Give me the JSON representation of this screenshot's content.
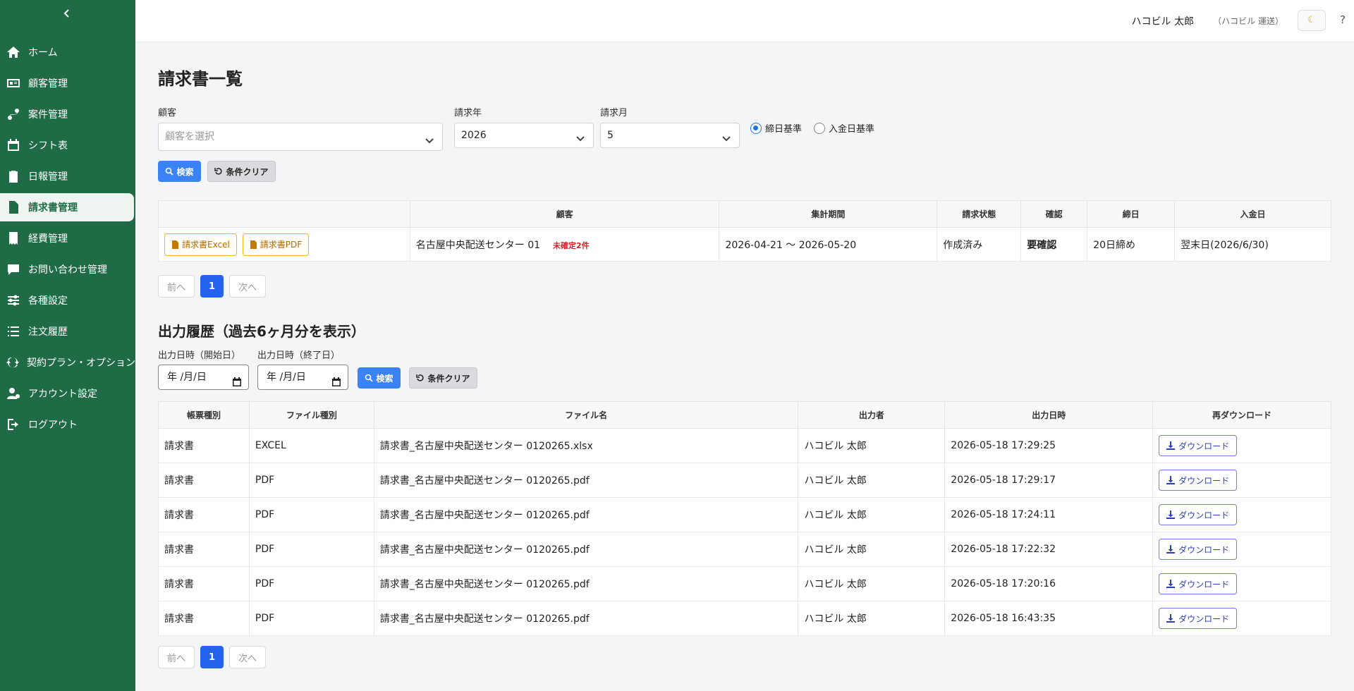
{
  "sidebar": {
    "collapse_icon": "chevron-left-icon",
    "items": [
      {
        "label": "ホーム",
        "icon": "home-icon"
      },
      {
        "label": "顧客管理",
        "icon": "id-card-icon"
      },
      {
        "label": "案件管理",
        "icon": "route-icon"
      },
      {
        "label": "シフト表",
        "icon": "calendar-icon"
      },
      {
        "label": "日報管理",
        "icon": "clipboard-icon"
      },
      {
        "label": "請求書管理",
        "icon": "invoice-icon",
        "active": true
      },
      {
        "label": "経費管理",
        "icon": "receipt-icon"
      },
      {
        "label": "お問い合わせ管理",
        "icon": "chat-icon"
      },
      {
        "label": "各種設定",
        "icon": "sliders-icon"
      },
      {
        "label": "注文履歴",
        "icon": "list-icon"
      },
      {
        "label": "契約プラン・オプション",
        "icon": "sync-icon"
      },
      {
        "label": "アカウント設定",
        "icon": "user-gear-icon"
      },
      {
        "label": "ログアウト",
        "icon": "logout-icon"
      }
    ]
  },
  "header": {
    "user_name": "ハコビル 太郎",
    "company": "（ハコビル 運送）",
    "theme_icon": "moon-icon",
    "help": "?"
  },
  "page_title": "請求書一覧",
  "filters": {
    "customer_label": "顧客",
    "customer_placeholder": "顧客を選択",
    "year_label": "請求年",
    "year_value": "2026",
    "month_label": "請求月",
    "month_value": "5",
    "radio_closing": "締日基準",
    "radio_payment": "入金日基準",
    "selected_radio": "締日基準",
    "search_label": "検索",
    "clear_label": "条件クリア"
  },
  "invoice_table": {
    "headers": [
      "",
      "顧客",
      "集計期間",
      "請求状態",
      "確認",
      "締日",
      "入金日"
    ],
    "rows": [
      {
        "excel_label": "請求書Excel",
        "pdf_label": "請求書PDF",
        "customer": "名古屋中央配送センター 01",
        "unconfirmed": "未確定2件",
        "period": "2026-04-21 〜 2026-05-20",
        "status": "作成済み",
        "confirm": "要確認",
        "closing": "20日締め",
        "payment": "翌末日(2026/6/30)"
      }
    ]
  },
  "pager1": {
    "prev": "前へ",
    "current": "1",
    "next": "次へ"
  },
  "history": {
    "title": "出力履歴（過去6ヶ月分を表示）",
    "start_label": "出力日時（開始日）",
    "end_label": "出力日時（終了日）",
    "start_value": "年 /月/日",
    "end_value": "年 /月/日",
    "search_label": "検索",
    "clear_label": "条件クリア",
    "headers": [
      "帳票種別",
      "ファイル種別",
      "ファイル名",
      "出力者",
      "出力日時",
      "再ダウンロード"
    ],
    "download_label": "ダウンロード",
    "rows": [
      {
        "type": "請求書",
        "file_type": "EXCEL",
        "file_name": "請求書_名古屋中央配送センター 0120265.xlsx",
        "user": "ハコビル 太郎",
        "datetime": "2026-05-18 17:29:25"
      },
      {
        "type": "請求書",
        "file_type": "PDF",
        "file_name": "請求書_名古屋中央配送センター 0120265.pdf",
        "user": "ハコビル 太郎",
        "datetime": "2026-05-18 17:29:17"
      },
      {
        "type": "請求書",
        "file_type": "PDF",
        "file_name": "請求書_名古屋中央配送センター 0120265.pdf",
        "user": "ハコビル 太郎",
        "datetime": "2026-05-18 17:24:11"
      },
      {
        "type": "請求書",
        "file_type": "PDF",
        "file_name": "請求書_名古屋中央配送センター 0120265.pdf",
        "user": "ハコビル 太郎",
        "datetime": "2026-05-18 17:22:32"
      },
      {
        "type": "請求書",
        "file_type": "PDF",
        "file_name": "請求書_名古屋中央配送センター 0120265.pdf",
        "user": "ハコビル 太郎",
        "datetime": "2026-05-18 17:20:16"
      },
      {
        "type": "請求書",
        "file_type": "PDF",
        "file_name": "請求書_名古屋中央配送センター 0120265.pdf",
        "user": "ハコビル 太郎",
        "datetime": "2026-05-18 16:43:35"
      }
    ]
  },
  "pager2": {
    "prev": "前へ",
    "current": "1",
    "next": "次へ"
  },
  "colors": {
    "sidebar": "#1f6b45",
    "primary": "#3b82f6",
    "alert": "#c62828",
    "doc_accent": "#f0b429"
  }
}
